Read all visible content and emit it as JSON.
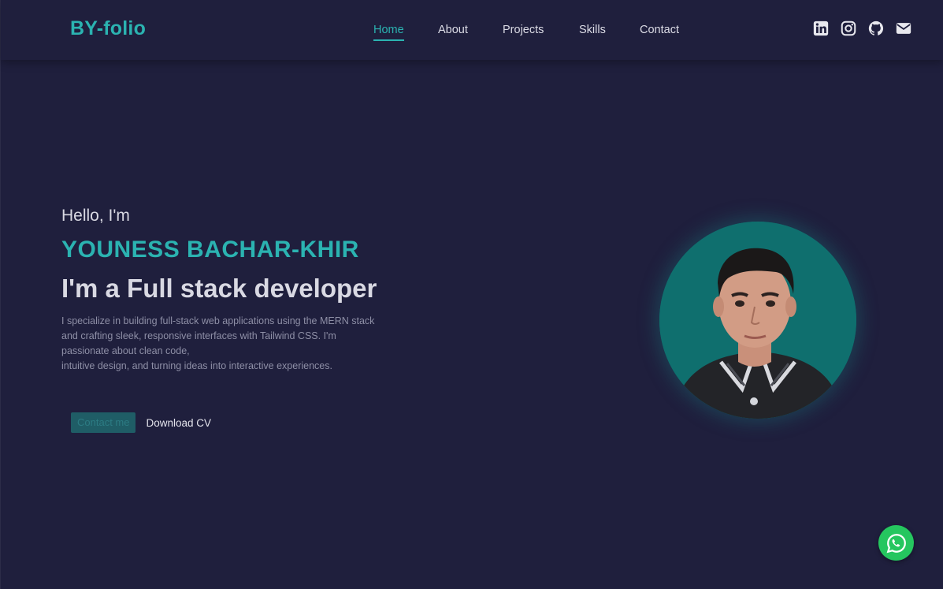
{
  "nav": {
    "brand": "BY-folio",
    "links": [
      {
        "label": "Home",
        "active": true
      },
      {
        "label": "About",
        "active": false
      },
      {
        "label": "Projects",
        "active": false
      },
      {
        "label": "Skills",
        "active": false
      },
      {
        "label": "Contact",
        "active": false
      }
    ],
    "socials": [
      "linkedin-icon",
      "instagram-icon",
      "github-icon",
      "mail-icon"
    ]
  },
  "hero": {
    "greeting": "Hello, I'm",
    "name": "YOUNESS BACHAR-KHIR",
    "role": "I'm a Full stack developer",
    "description_lines": [
      "I specialize in building full-stack web applications using the MERN stack",
      "and crafting sleek, responsive interfaces with Tailwind CSS. I'm",
      "passionate about clean code,",
      "intuitive design, and turning ideas into interactive experiences."
    ],
    "contact_button": "Contact me",
    "download_cv": "Download CV"
  },
  "floating": {
    "whatsapp": "whatsapp-icon"
  },
  "colors": {
    "background": "#1f1f3d",
    "accent": "#2bb3b1",
    "whatsapp": "#25c65f",
    "avatar_bg": "#0e6e6d"
  }
}
